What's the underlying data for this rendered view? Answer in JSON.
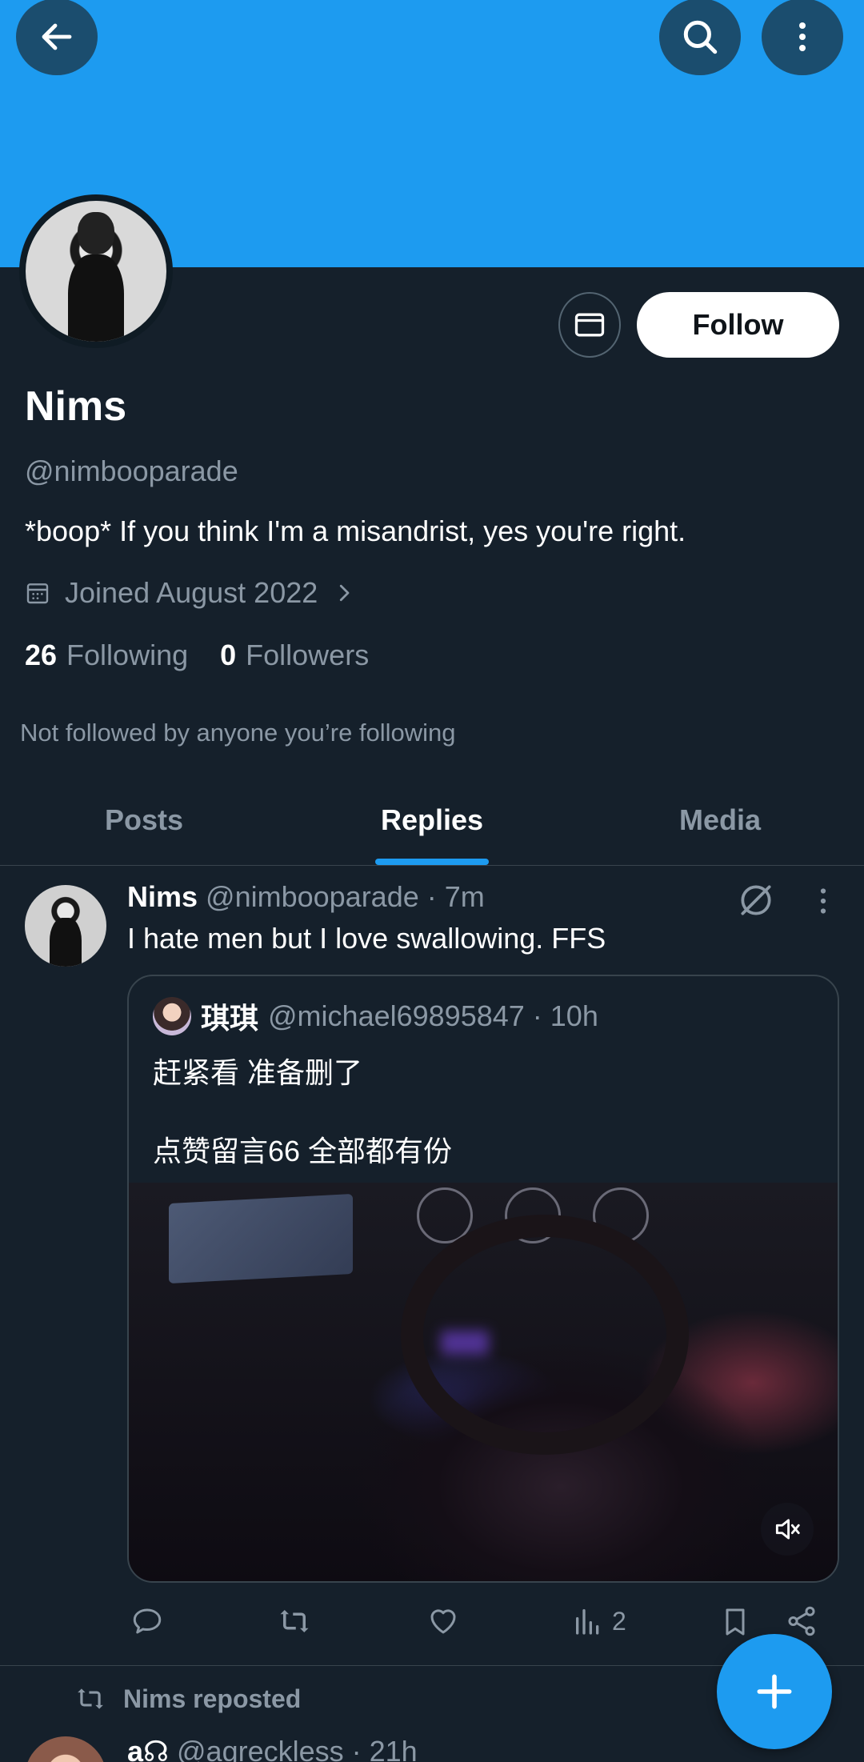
{
  "profile": {
    "name": "Nims",
    "handle": "@nimbooparade",
    "bio": "*boop*  If you think I'm a misandrist, yes you're right.",
    "joined": "Joined August 2022",
    "following_count": "26",
    "following_label": "Following",
    "followers_count": "0",
    "followers_label": "Followers",
    "not_followed": "Not followed by anyone you’re following",
    "follow_label": "Follow"
  },
  "tabs": [
    {
      "label": "Posts"
    },
    {
      "label": "Replies",
      "active": true
    },
    {
      "label": "Media"
    }
  ],
  "post": {
    "author": "Nims",
    "meta": "@nimbooparade · 7m",
    "text": "I hate men but I love swallowing. FFS",
    "quote": {
      "author": "琪琪",
      "meta": "@michael69895847 · 10h",
      "line1": "赶紧看  准备删了",
      "line2": "点赞留言66  全部都有份"
    },
    "views": "2"
  },
  "next": {
    "repost_label": "Nims reposted",
    "author": "a☊",
    "meta": "@agreckless · 21h"
  },
  "colors": {
    "background": "#15202b",
    "accent": "#1d9bf0",
    "secondary_text": "#8b98a5",
    "border": "#38444d"
  },
  "icons": [
    "back-arrow-icon",
    "search-icon",
    "more-vertical-icon",
    "mail-icon",
    "calendar-icon",
    "chevron-right-icon",
    "grok-icon",
    "reply-icon",
    "repost-icon",
    "like-icon",
    "views-icon",
    "bookmark-icon",
    "share-icon",
    "mute-icon",
    "plus-icon"
  ]
}
